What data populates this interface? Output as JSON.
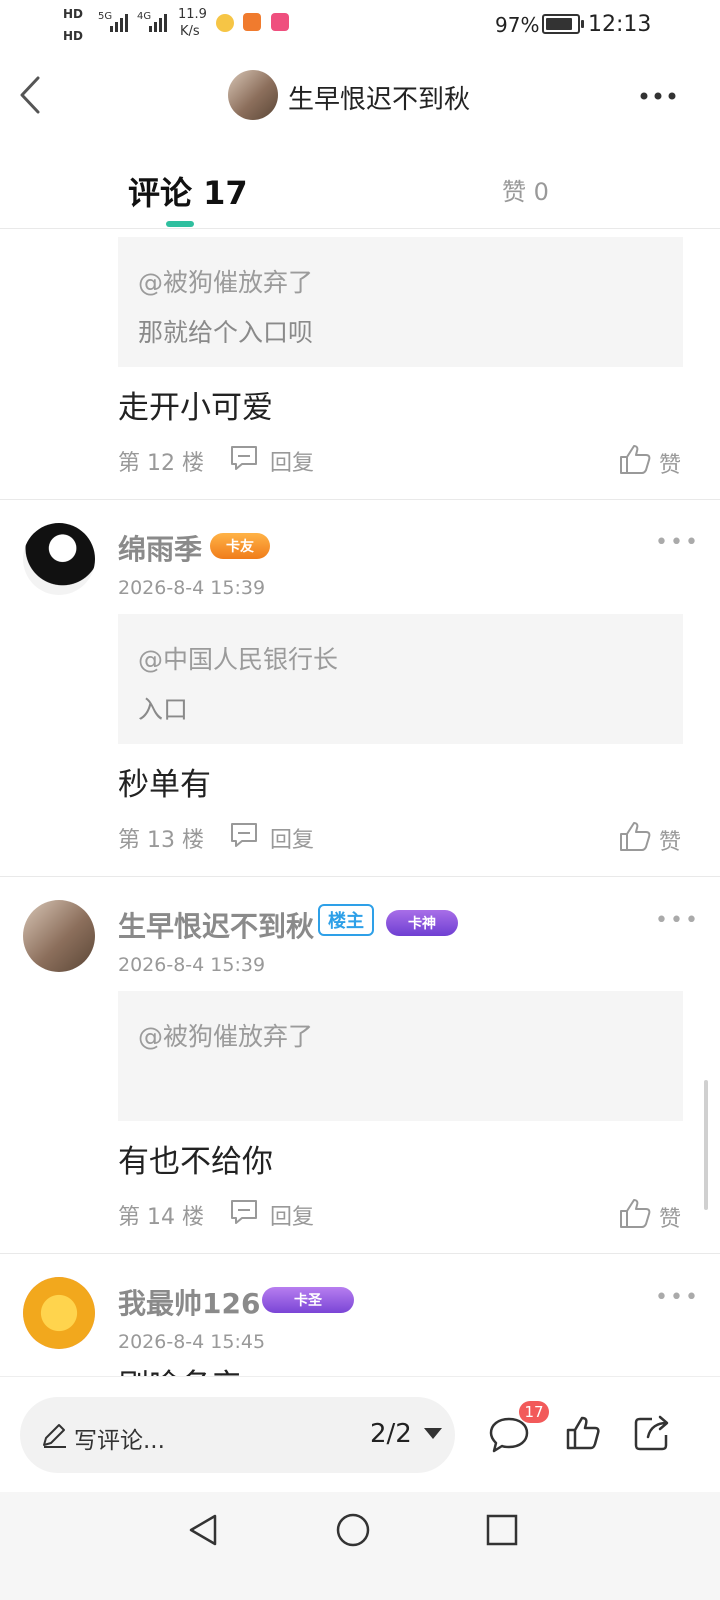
{
  "status_bar": {
    "hd1": "HD",
    "hd2": "HD",
    "net1": "5G",
    "net2": "4G",
    "speed_value": "11.9",
    "speed_unit": "K/s",
    "battery_percent": "97%",
    "time": "12:13"
  },
  "header": {
    "title": "生早恨迟不到秋"
  },
  "tabs": {
    "comments_label": "评论 17",
    "likes_label": "赞 0"
  },
  "comments": [
    {
      "quote_at": "@被狗催放弃了",
      "quote_text": "那就给个入口呗",
      "content": "走开小可爱",
      "floor": "第 12 楼",
      "reply": "回复",
      "like": "赞"
    },
    {
      "name": "绵雨季",
      "rank": "卡友",
      "time": "2026-8-4 15:39",
      "quote_at": "@中国人民银行长",
      "quote_text": "入口",
      "content": "秒单有",
      "floor": "第 13 楼",
      "reply": "回复",
      "like": "赞"
    },
    {
      "name": "生早恨迟不到秋",
      "owner_badge": "楼主",
      "rank": "卡神",
      "time": "2026-8-4 15:39",
      "quote_at": "@被狗催放弃了",
      "quote_text": "",
      "content": "有也不给你",
      "floor": "第 14 楼",
      "reply": "回复",
      "like": "赞"
    },
    {
      "name": "我最帅126",
      "rank": "卡圣",
      "time": "2026-8-4 15:45",
      "content": "刷啥名产"
    }
  ],
  "bottom_bar": {
    "input_placeholder": "写评论...",
    "page_indicator": "2/2",
    "comment_count": "17"
  },
  "colors": {
    "accent": "#2fbf9f",
    "owner_badge": "#2ea0e8",
    "count_badge": "#f25a5a"
  }
}
